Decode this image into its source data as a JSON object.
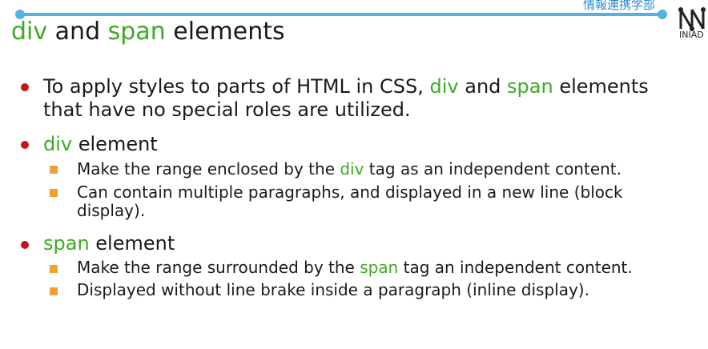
{
  "header": {
    "faculty": "情報連携学部",
    "logo_text": "INIAD",
    "title_prefix": "div",
    "title_mid": " and ",
    "title_kw": "span",
    "title_suffix": " elements"
  },
  "bullets": [
    {
      "line1_a": "To apply styles to parts of HTML in CSS, ",
      "line1_kw1": "div",
      "line1_b": " and ",
      "line1_kw2": "span",
      "line1_c": " elements",
      "line2": "that have no special roles are utilized."
    },
    {
      "kw": "div",
      "rest": " element",
      "subs": [
        {
          "a": "Make the range enclosed by the ",
          "kw": "div",
          "b": " tag as an independent content."
        },
        {
          "line1": "Can contain multiple paragraphs, and displayed in a new line (block",
          "line2": "display)."
        }
      ]
    },
    {
      "kw": "span",
      "rest": " element",
      "subs": [
        {
          "a": "Make the range surrounded by the ",
          "kw": "span",
          "b": " tag an independent content."
        },
        {
          "line1": "Displayed without line brake inside a paragraph (inline display)."
        }
      ]
    }
  ],
  "colors": {
    "accent_line": "#56b0e0",
    "keyword_green": "#3cab23",
    "bullet_red": "#c0161b",
    "sub_bullet_orange": "#f2a030"
  }
}
